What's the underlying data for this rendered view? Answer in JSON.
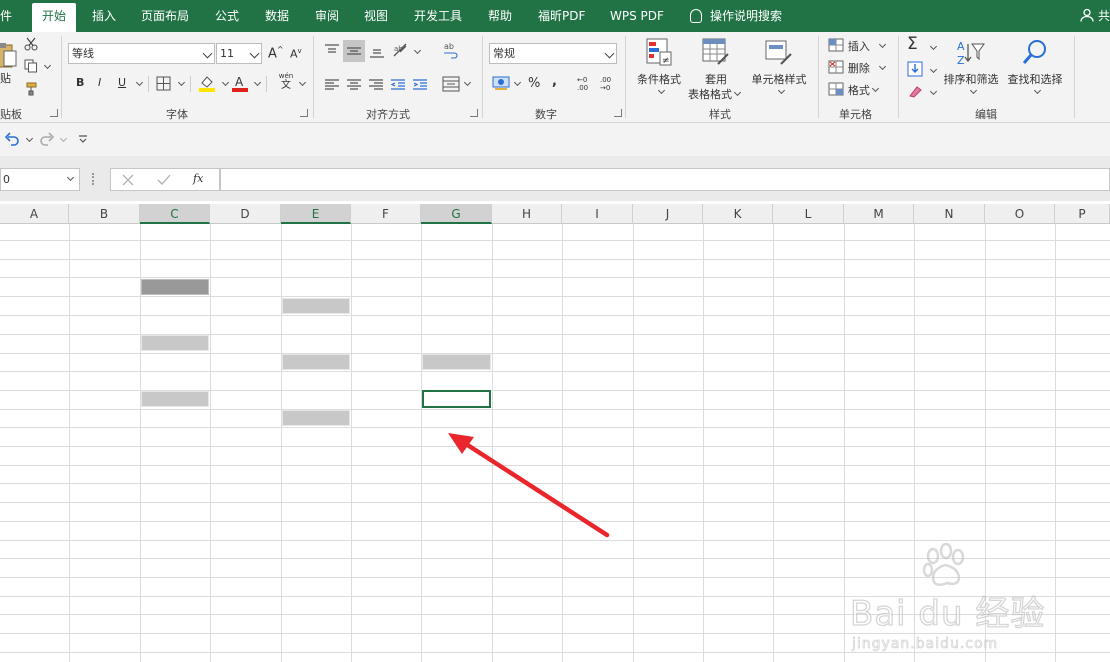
{
  "tabs": [
    "件",
    "开始",
    "插入",
    "页面布局",
    "公式",
    "数据",
    "审阅",
    "视图",
    "开发工具",
    "帮助",
    "福昕PDF",
    "WPS PDF",
    "操作说明搜索"
  ],
  "share_label": "共",
  "ribbon": {
    "clipboard": {
      "paste": "贴",
      "label": "贴板"
    },
    "font": {
      "name": "等线",
      "size": "11",
      "grow": "A",
      "shrink": "A",
      "bold": "B",
      "italic": "I",
      "underline": "U",
      "phonetic_top": "wén",
      "phonetic_bottom": "文",
      "label": "字体"
    },
    "align": {
      "label": "对齐方式"
    },
    "number": {
      "format": "常规",
      "percent": "%",
      "comma": ",",
      "inc_decimal": "←0 .00",
      "dec_decimal": ".00 →0",
      "label": "数字"
    },
    "styles": {
      "conditional": "条件格式",
      "table_top": "套用",
      "table_bottom": "表格格式",
      "cell_styles": "单元格样式",
      "label": "样式"
    },
    "cells": {
      "insert": "插入",
      "delete": "删除",
      "format": "格式",
      "label": "单元格"
    },
    "editing": {
      "sum": "Σ",
      "sort_filter": "排序和筛选",
      "find_select": "查找和选择",
      "label": "编辑"
    }
  },
  "name_box": "0",
  "fx": "fx",
  "columns": [
    "A",
    "B",
    "C",
    "D",
    "E",
    "F",
    "G",
    "H",
    "I",
    "J",
    "K",
    "L",
    "M",
    "N",
    "O",
    "P"
  ],
  "colors": {
    "brand": "#217346",
    "arrow": "#e8262c"
  },
  "watermark": {
    "brand_text": "Bai du 经验",
    "url": "jingyan.baidu.com"
  }
}
